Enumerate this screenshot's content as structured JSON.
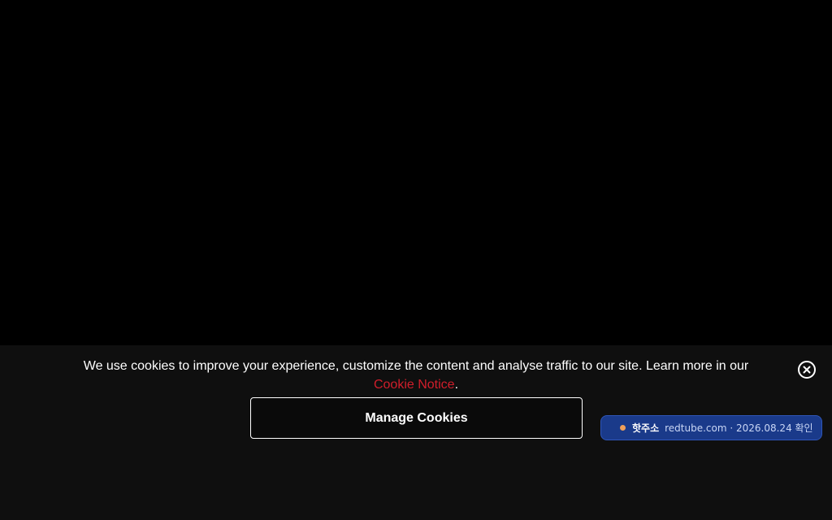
{
  "cookie_banner": {
    "text_before_link": "We use cookies to improve your experience, customize the content and analyse traffic to our site. Learn more in our ",
    "link_text": "Cookie Notice",
    "text_after_link": ".",
    "manage_button_label": "Manage Cookies",
    "close_icon": "close-circle-icon",
    "link_color": "#d11e2b"
  },
  "notice_pill": {
    "label": "핫주소",
    "info": "redtube.com · 2026.08.24 확인",
    "dot_color": "#f0a05a"
  }
}
